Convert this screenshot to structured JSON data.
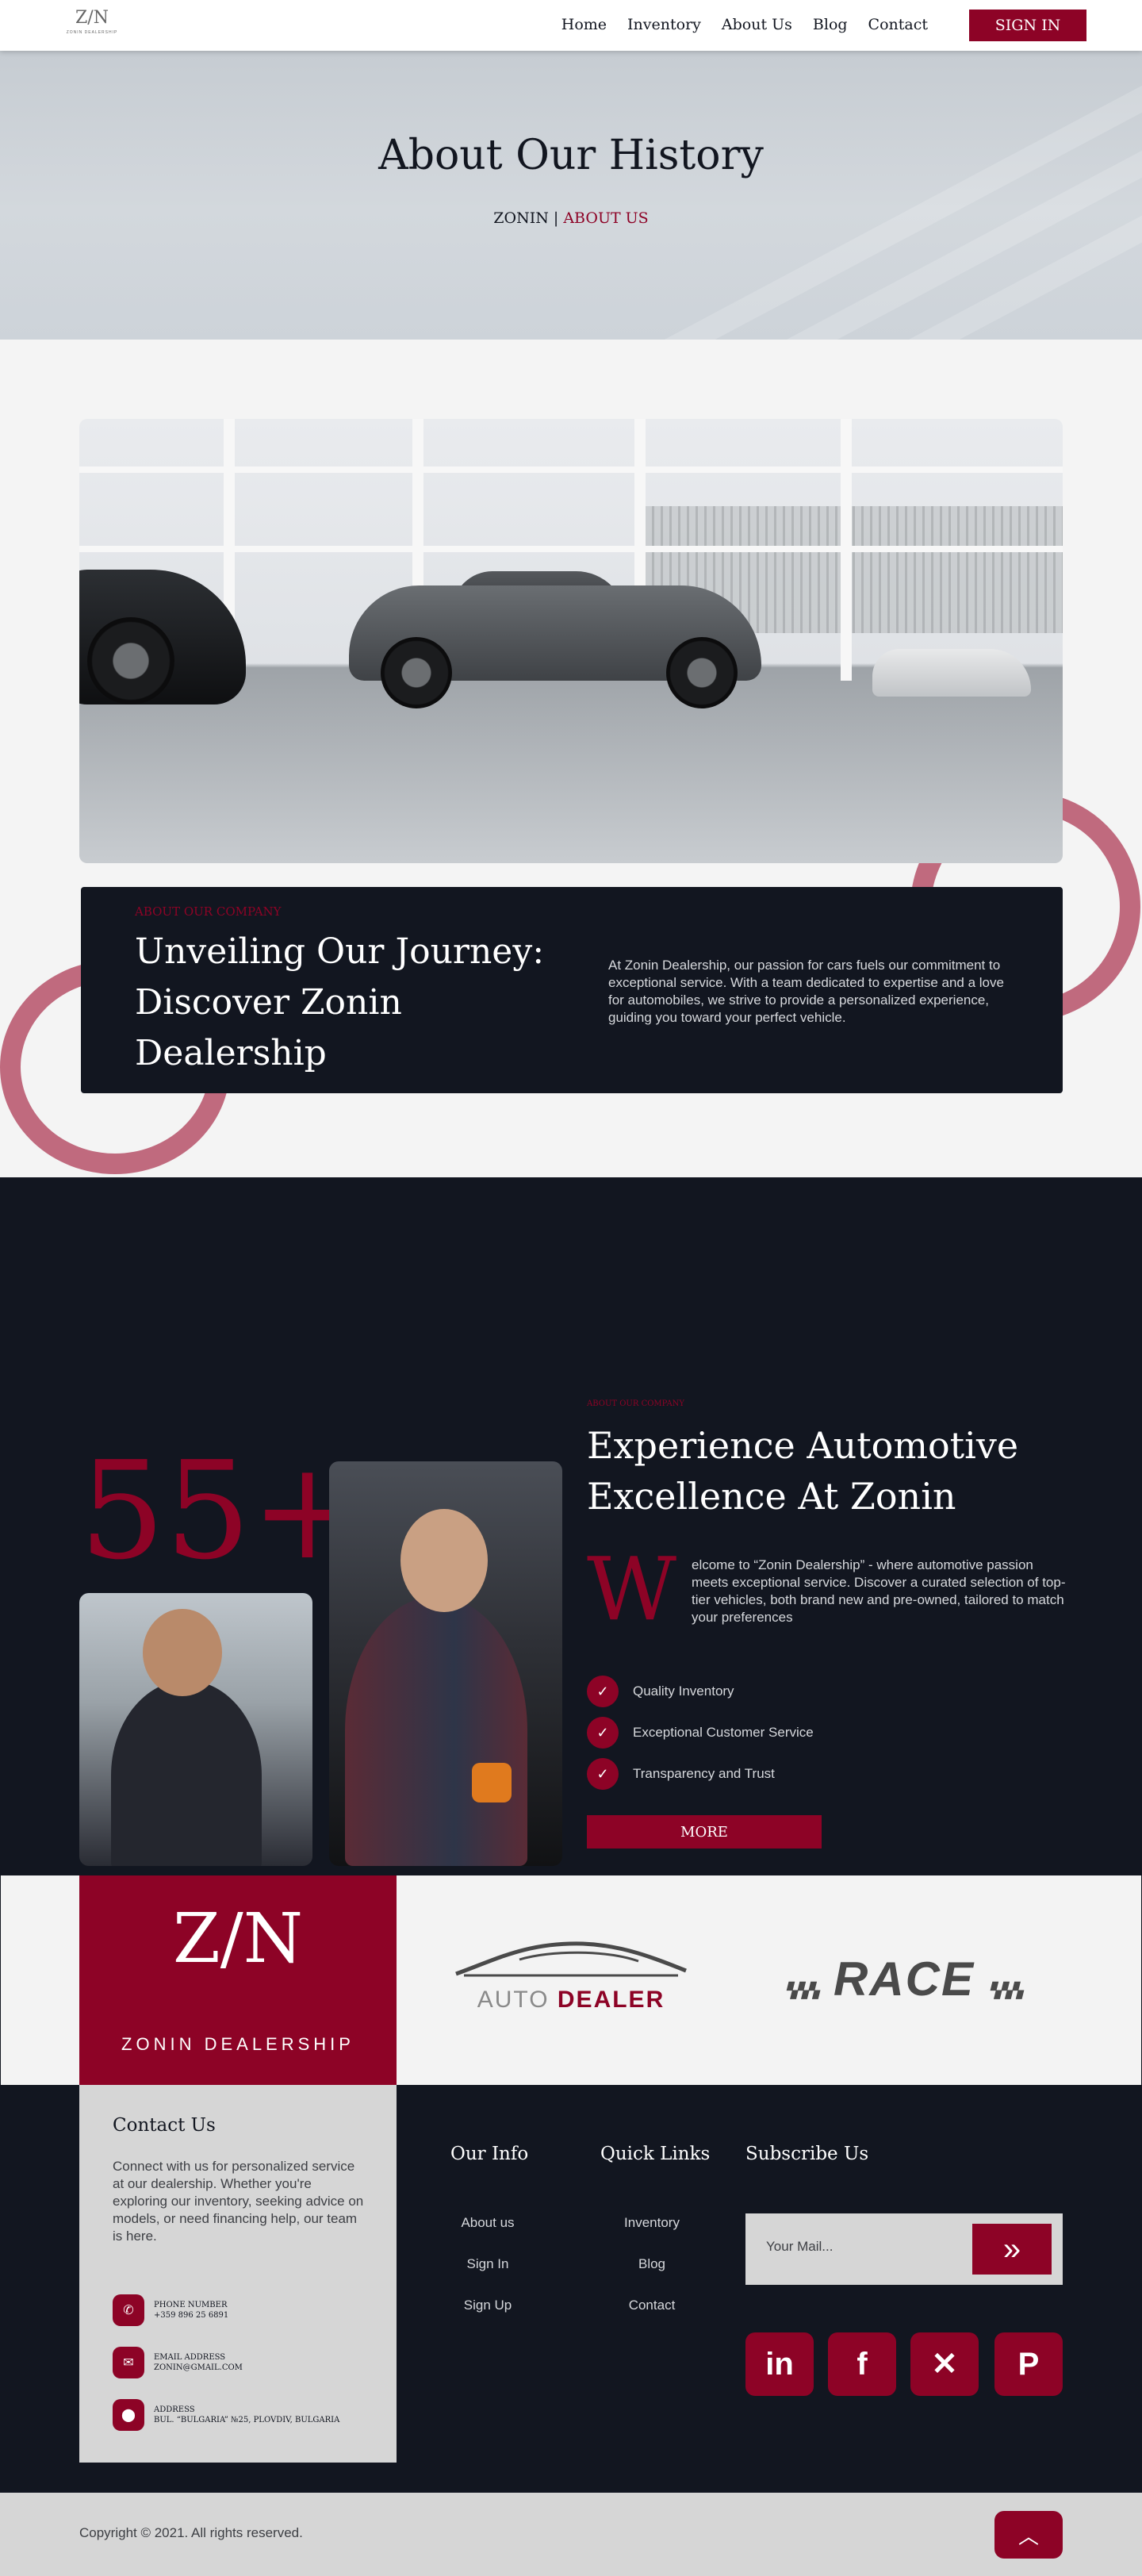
{
  "nav": {
    "logo_mark": "Z/N",
    "logo_text": "ZONIN DEALERSHIP",
    "links": [
      "Home",
      "Inventory",
      "About Us",
      "Blog",
      "Contact"
    ],
    "signin_label": "SIGN IN"
  },
  "hero": {
    "title": "About Our History",
    "crumb_home": "ZONIN",
    "crumb_sep": " | ",
    "crumb_active": "ABOUT US"
  },
  "journey": {
    "tag": "ABOUT OUR COMPANY",
    "heading": "Unveiling Our Journey: Discover Zonin Dealership",
    "body": "At Zonin Dealership, our passion for cars fuels our commitment to exceptional service. With a team dedicated to expertise and a love for automobiles, we strive to provide a personalized experience, guiding you toward your perfect vehicle."
  },
  "experience": {
    "count": "55+",
    "tag": "ABOUT OUR COMPANY",
    "heading": "Experience Automotive Excellence At Zonin",
    "dropcap": "W",
    "body": "elcome to “Zonin Dealership” - where automotive passion meets exceptional service. Discover a curated selection of top-tier vehicles, both brand new and pre-owned, tailored to match your preferences",
    "checks": [
      "Quality Inventory",
      "Exceptional Customer Service",
      "Transparency and Trust"
    ],
    "more_label": "MORE"
  },
  "brands": {
    "zonin_mark": "Z/N",
    "zonin_name": "ZONIN DEALERSHIP",
    "auto": "AUTO",
    "dealer": "DEALER",
    "race": "RACE"
  },
  "footer": {
    "contact_title": "Contact Us",
    "contact_body": "Connect with us for personalized service at our dealership. Whether you're exploring our inventory, seeking advice on models, or need financing help, our team is here.",
    "phone_label": "PHONE NUMBER",
    "phone_value": "+359 896 25 6891",
    "email_label": "EMAIL ADDRESS",
    "email_value": "ZONIN@GMAIL.COM",
    "address_label": "ADDRESS",
    "address_value": "BUL. “BULGARIA” №25, PLOVDIV, BULGARIA",
    "our_info_title": "Our Info",
    "our_info_links": [
      "About us",
      "Sign In",
      "Sign Up"
    ],
    "quick_title": "Quick Links",
    "quick_links": [
      "Inventory",
      "Blog",
      "Contact"
    ],
    "subscribe_title": "Subscribe Us",
    "subscribe_placeholder": "Your Mail...",
    "social": [
      "in",
      "f",
      "✕",
      "P"
    ],
    "copyright": "Copyright © 2021. All rights reserved."
  },
  "colors": {
    "accent": "#8d0326",
    "dark": "#121620",
    "ring": "#c06a7e"
  }
}
